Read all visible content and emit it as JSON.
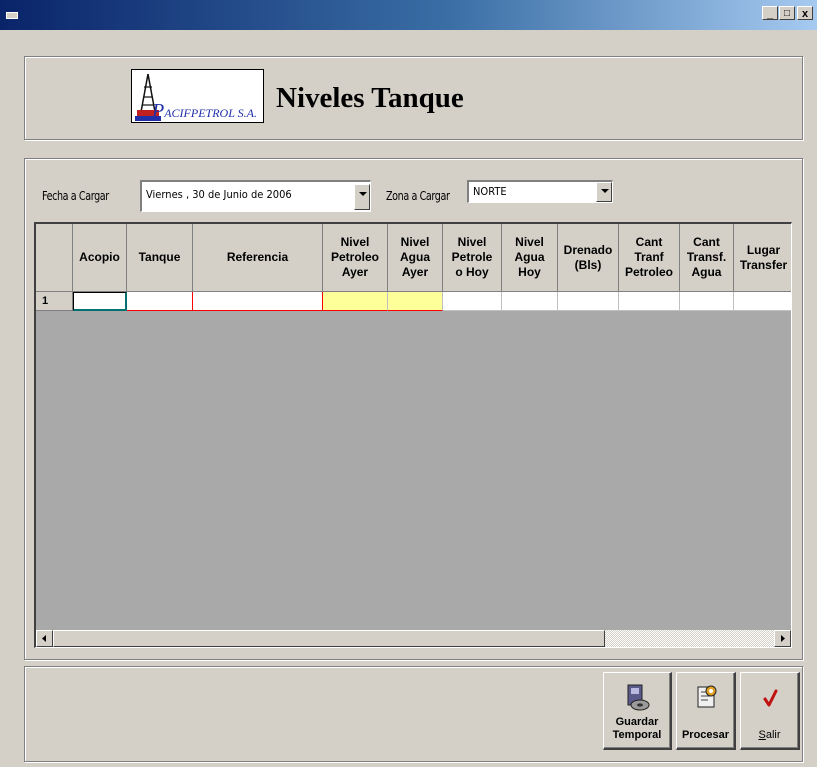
{
  "window": {
    "minimize_glyph": "_",
    "maximize_glyph": "□",
    "close_glyph": "x"
  },
  "header": {
    "logo_initial": "P",
    "logo_name": "ACIFPETROL S.A.",
    "title": "Niveles Tanque"
  },
  "filters": {
    "fecha_label": "Fecha a Cargar",
    "fecha_value": "Viernes , 30 de    Junio    de 2006",
    "zona_label": "Zona a Cargar",
    "zona_value": "NORTE"
  },
  "grid": {
    "columns": [
      [
        "Acopio"
      ],
      [
        "Tanque"
      ],
      [
        "Referencia"
      ],
      [
        "Nivel",
        "Petroleo",
        "Ayer"
      ],
      [
        "Nivel",
        "Agua",
        "Ayer"
      ],
      [
        "Nivel",
        "Petrole",
        "o Hoy"
      ],
      [
        "Nivel",
        "Agua",
        "Hoy"
      ],
      [
        "Drenado",
        "(Bls)"
      ],
      [
        "Cant",
        "Tranf",
        "Petroleo"
      ],
      [
        "Cant",
        "Transf.",
        "Agua"
      ],
      [
        "Lugar",
        "Transfer"
      ]
    ],
    "rows": [
      {
        "number": "1",
        "cells": [
          "",
          "",
          "",
          "",
          "",
          "",
          "",
          "",
          "",
          "",
          ""
        ]
      }
    ]
  },
  "actions": {
    "guardar_line1": "Guardar",
    "guardar_line2": "Temporal",
    "procesar": "Procesar",
    "salir_mnemonic": "S",
    "salir_rest": "alir"
  },
  "colors": {
    "titlebar_start": "#0a246a",
    "titlebar_end": "#a6caf0",
    "face": "#d4d0c8",
    "grid_empty": "#a9a9a9",
    "highlight_yellow": "#ffff99",
    "required_red": "#ff0000"
  }
}
